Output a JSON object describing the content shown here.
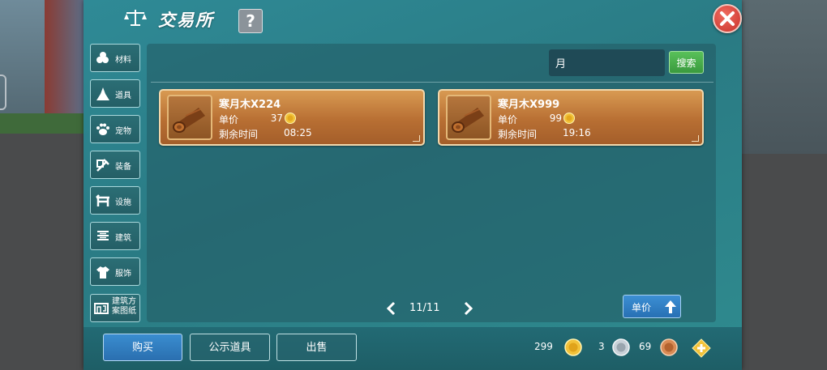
{
  "header": {
    "title": "交易所",
    "help_label": "?"
  },
  "sidebar": {
    "items": [
      {
        "label": "材料",
        "icon": "materials-icon"
      },
      {
        "label": "道具",
        "icon": "tool-icon"
      },
      {
        "label": "宠物",
        "icon": "paw-icon"
      },
      {
        "label": "装备",
        "icon": "equipment-icon"
      },
      {
        "label": "设施",
        "icon": "facility-icon"
      },
      {
        "label": "建筑",
        "icon": "building-icon"
      },
      {
        "label": "服饰",
        "icon": "clothing-icon"
      },
      {
        "label": "建筑方案图纸",
        "icon": "blueprint-icon"
      }
    ]
  },
  "search": {
    "value": "月",
    "button_label": "搜索"
  },
  "listings": [
    {
      "name": "寒月木X224",
      "price_label": "单价",
      "price": "37",
      "time_label": "剩余时间",
      "time": "08:25"
    },
    {
      "name": "寒月木X999",
      "price_label": "单价",
      "price": "99",
      "time_label": "剩余时间",
      "time": "19:16"
    }
  ],
  "pagination": {
    "text": "11/11"
  },
  "sort": {
    "label": "单价"
  },
  "actions": {
    "buy": "购买",
    "public": "公示道具",
    "sell": "出售"
  },
  "currency": {
    "gold": "299",
    "silver": "3",
    "copper": "69"
  },
  "colors": {
    "panel": "#2f8a96",
    "listing": "#c98443",
    "accent_blue": "#2a6fb0",
    "accent_green": "#3a9a3e",
    "close": "#c8322b"
  }
}
